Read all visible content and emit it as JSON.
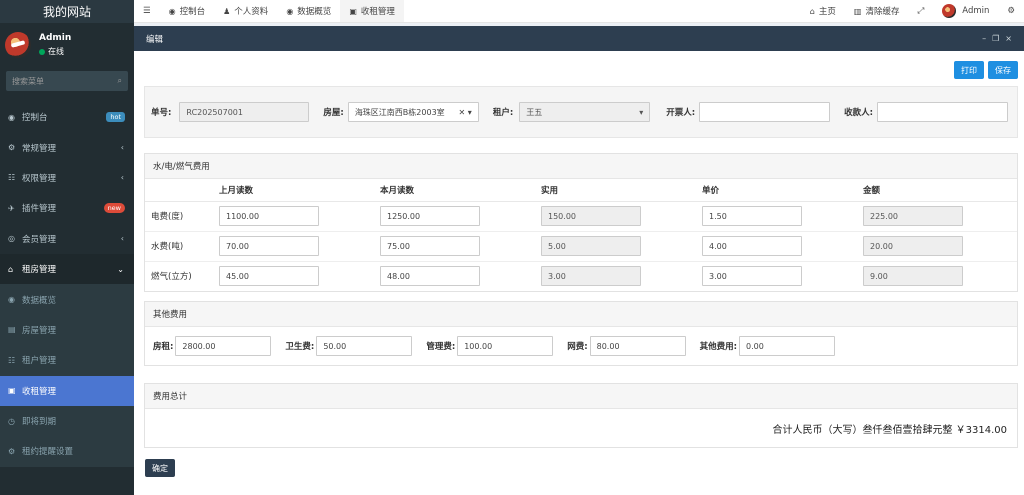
{
  "sidebar": {
    "logo": "我的网站",
    "user": {
      "name": "Admin",
      "status": "在线"
    },
    "search_placeholder": "搜索菜单",
    "items": [
      {
        "icon": "dashboard-icon",
        "glyph": "◉",
        "label": "控制台",
        "badge": "hot"
      },
      {
        "icon": "cogs-icon",
        "glyph": "⚙",
        "label": "常规管理",
        "chevron": "‹"
      },
      {
        "icon": "users-icon",
        "glyph": "☷",
        "label": "权限管理",
        "chevron": "‹"
      },
      {
        "icon": "plug-icon",
        "glyph": "✈",
        "label": "插件管理",
        "badge": "new"
      },
      {
        "icon": "member-icon",
        "glyph": "◎",
        "label": "会员管理",
        "chevron": "‹"
      },
      {
        "icon": "home-icon",
        "glyph": "⌂",
        "label": "租房管理",
        "chevron": "⌄"
      },
      {
        "icon": "overview-icon",
        "glyph": "◉",
        "label": "数据概览"
      },
      {
        "icon": "building-icon",
        "glyph": "▤",
        "label": "房屋管理"
      },
      {
        "icon": "tenants-icon",
        "glyph": "☷",
        "label": "租户管理"
      },
      {
        "icon": "money-icon",
        "glyph": "▣",
        "label": "收租管理"
      },
      {
        "icon": "clock-icon",
        "glyph": "◷",
        "label": "即将到期"
      },
      {
        "icon": "settings-icon",
        "glyph": "⚙",
        "label": "租约提醒设置"
      }
    ]
  },
  "topnav": {
    "menu_icon": "☰",
    "tabs": [
      {
        "icon": "dashboard-icon",
        "glyph": "◉",
        "label": "控制台"
      },
      {
        "icon": "user-icon",
        "glyph": "♟",
        "label": "个人资料"
      },
      {
        "icon": "overview-icon",
        "glyph": "◉",
        "label": "数据概览"
      },
      {
        "icon": "money-icon",
        "glyph": "▣",
        "label": "收租管理"
      }
    ],
    "home_label": "主页",
    "clear_cache_label": "清除缓存",
    "admin_label": "Admin"
  },
  "panel": {
    "title": "编辑"
  },
  "toolbar": {
    "print_label": "打印",
    "save_label": "保存"
  },
  "header_form": {
    "number_label": "单号:",
    "number_value": "RC202507001",
    "house_label": "房屋:",
    "house_value": "海珠区江南西B栋2003室",
    "tenant_label": "租户:",
    "tenant_value": "王五",
    "issuer_label": "开票人:",
    "issuer_value": "",
    "payee_label": "收款人:",
    "payee_value": ""
  },
  "utilities": {
    "title": "水/电/燃气费用",
    "columns": [
      "",
      "上月读数",
      "本月读数",
      "实用",
      "单价",
      "金额"
    ],
    "rows": [
      {
        "name": "电费(度)",
        "prev": "1100.00",
        "curr": "1250.00",
        "used": "150.00",
        "price": "1.50",
        "amount": "225.00"
      },
      {
        "name": "水费(吨)",
        "prev": "70.00",
        "curr": "75.00",
        "used": "5.00",
        "price": "4.00",
        "amount": "20.00"
      },
      {
        "name": "燃气(立方)",
        "prev": "45.00",
        "curr": "48.00",
        "used": "3.00",
        "price": "3.00",
        "amount": "9.00"
      }
    ]
  },
  "other_fees": {
    "title": "其他费用",
    "items": [
      {
        "label": "房租:",
        "value": "2800.00"
      },
      {
        "label": "卫生费:",
        "value": "50.00"
      },
      {
        "label": "管理费:",
        "value": "100.00"
      },
      {
        "label": "网费:",
        "value": "80.00"
      },
      {
        "label": "其他费用:",
        "value": "0.00"
      }
    ]
  },
  "summary": {
    "title": "费用总计",
    "total_text": "合计人民币（大写）叁仟叁佰壹拾肆元整 ￥3314.00"
  },
  "confirm_label": "确定"
}
